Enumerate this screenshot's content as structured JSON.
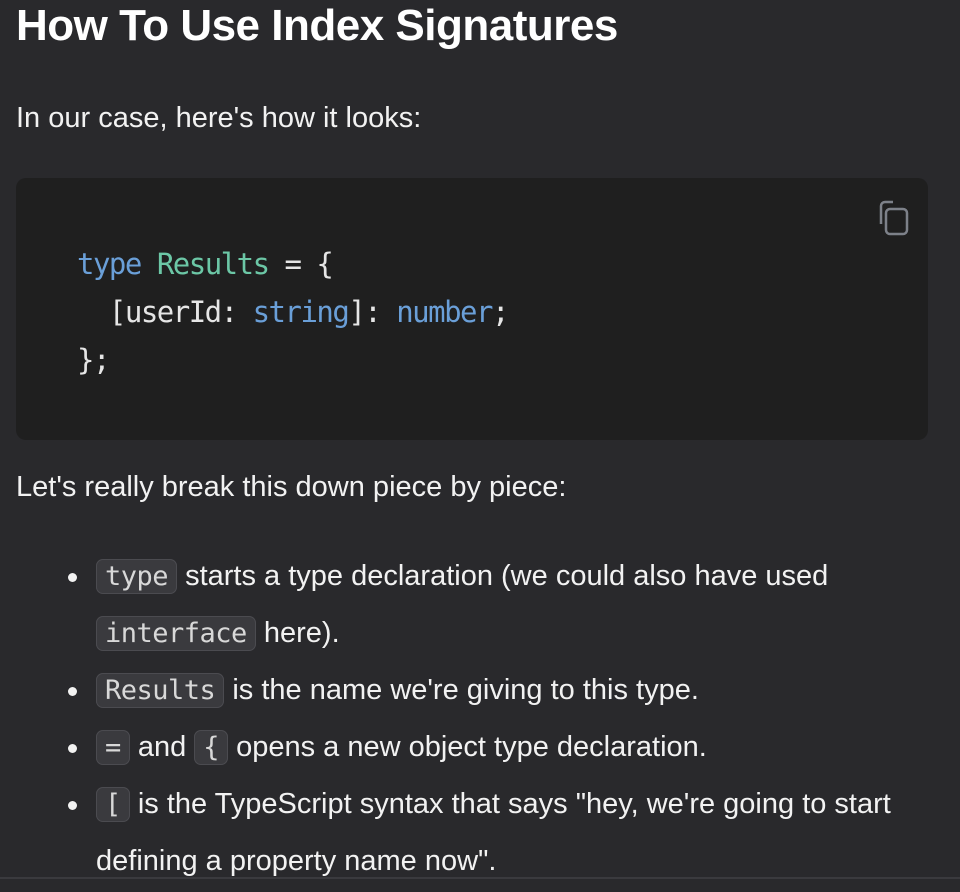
{
  "heading": "How To Use Index Signatures",
  "intro": "In our case, here's how it looks:",
  "code_block": {
    "copy_icon": "copy-icon",
    "line1": {
      "kw": "type",
      "name": "Results",
      "rest": " = {"
    },
    "line2": {
      "a": "  [userId: ",
      "t1": "string",
      "b": "]: ",
      "t2": "number",
      "c": ";"
    },
    "line3": "};"
  },
  "breakdown_intro": "Let's really break this down piece by piece:",
  "list": [
    {
      "code": "type",
      "text": " starts a type declaration (we could also have used ",
      "code2": "interface",
      "text2": " here)."
    },
    {
      "code": "Results",
      "text": " is the name we're giving to this type."
    },
    {
      "code": "=",
      "text": " and ",
      "code2": "{",
      "text2": " opens a new object type declaration."
    },
    {
      "code": "[",
      "text": " is the TypeScript syntax that says \"hey, we're going to start defining a property name now\"."
    }
  ],
  "colors": {
    "background": "#29292c",
    "code_bg": "#1f1f1f",
    "keyword": "#6a9fd8",
    "type_name": "#6cc7a6"
  }
}
